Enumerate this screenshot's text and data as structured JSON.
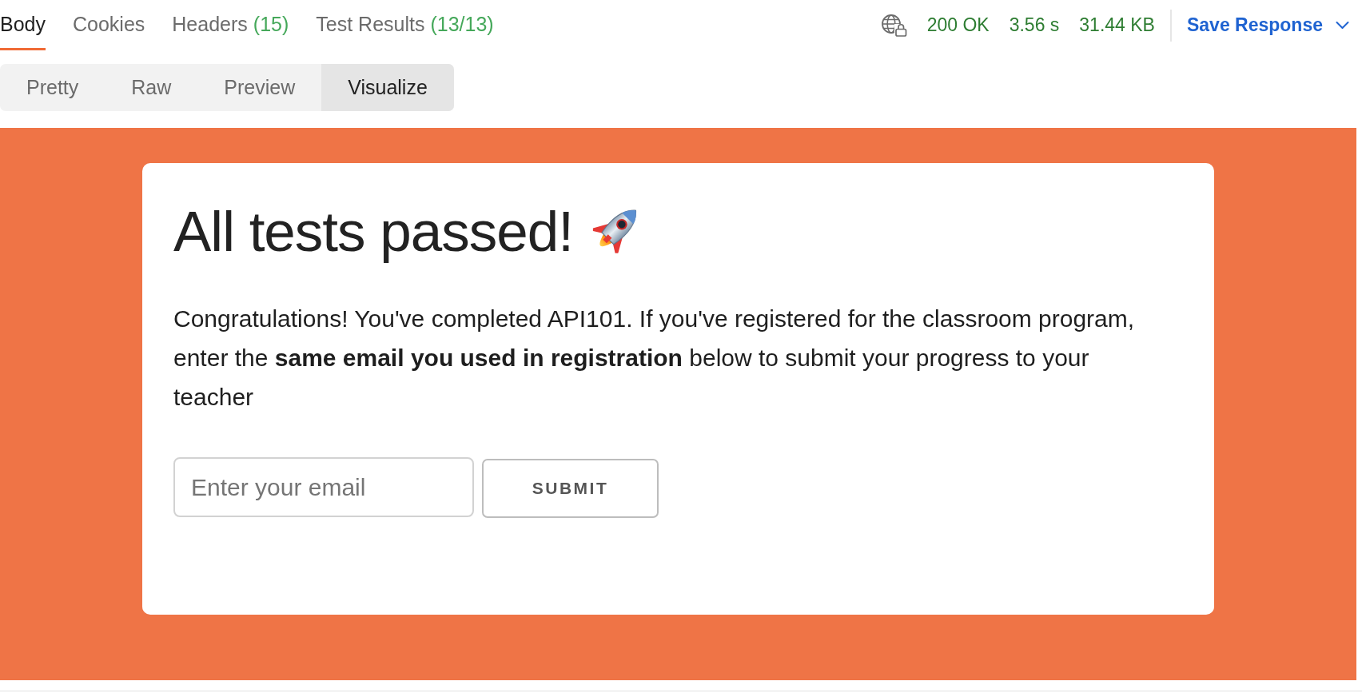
{
  "response_tabs": [
    {
      "label": "Body",
      "selected": true
    },
    {
      "label": "Cookies",
      "selected": false
    },
    {
      "label": "Headers",
      "count": "(15)",
      "selected": false
    },
    {
      "label": "Test Results",
      "count": "(13/13)",
      "selected": false
    }
  ],
  "status": {
    "code": "200 OK",
    "time": "3.56 s",
    "size": "31.44 KB"
  },
  "save_button": {
    "label": "Save Response"
  },
  "view_tabs": [
    {
      "label": "Pretty",
      "selected": false
    },
    {
      "label": "Raw",
      "selected": false
    },
    {
      "label": "Preview",
      "selected": false
    },
    {
      "label": "Visualize",
      "selected": true
    }
  ],
  "visualization": {
    "heading": "All tests passed!",
    "message": "Congratulations! You've completed API101. If you've registered for the classroom program, enter the **same email you used in registration** below to submit your progress to your teacher",
    "email_field": {
      "placeholder": "Enter your email"
    },
    "submit_button": {
      "label": "SUBMIT"
    }
  }
}
